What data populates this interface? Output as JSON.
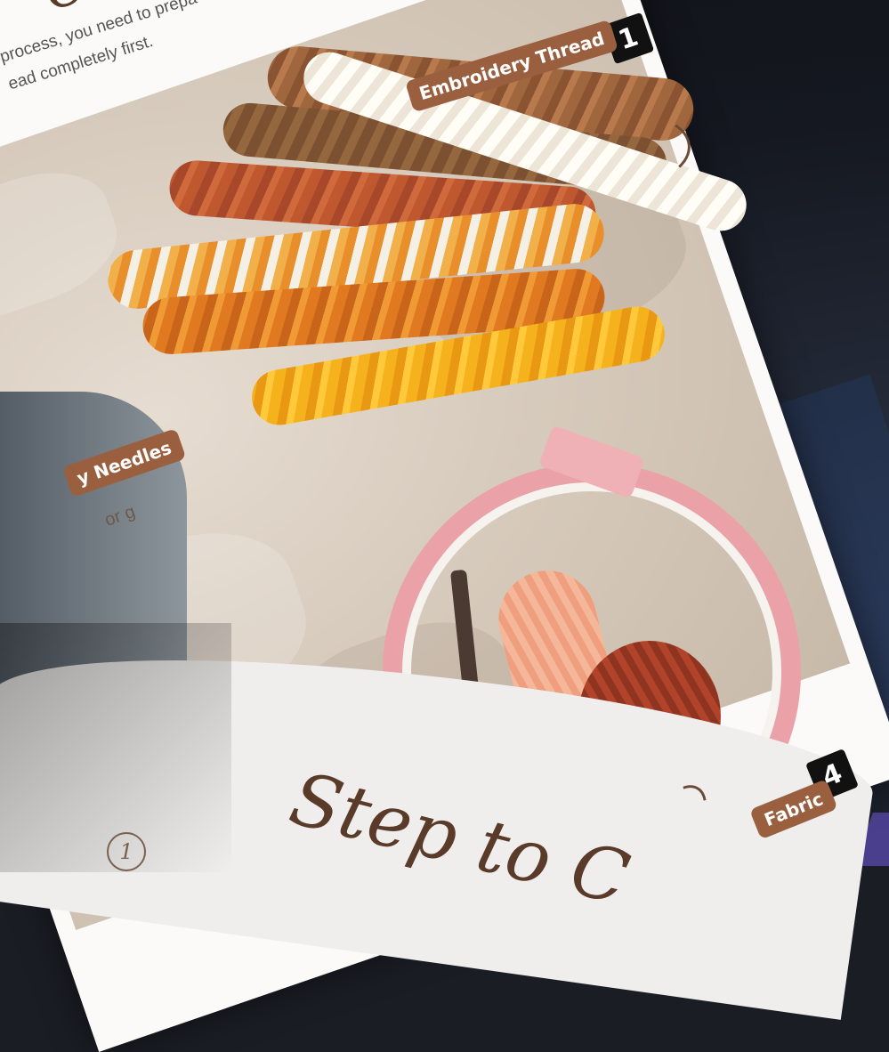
{
  "page": {
    "title_fragment": "Co",
    "intro_line_1": "process, you need to prepa",
    "intro_line_2": "ead completely first."
  },
  "labels": {
    "embroidery_thread": "Embroidery Thread",
    "needles": "y Needles",
    "needles_sub": "or g",
    "fabric": "Fabric"
  },
  "badges": {
    "first": "1",
    "fourth": "4"
  },
  "book": {
    "step_title": "Step to C",
    "step_number": "1"
  },
  "colors": {
    "tag": "#9a5f3f",
    "badge": "#111111",
    "script_text": "#5a3a28",
    "hoop": "#eaa2a8"
  }
}
